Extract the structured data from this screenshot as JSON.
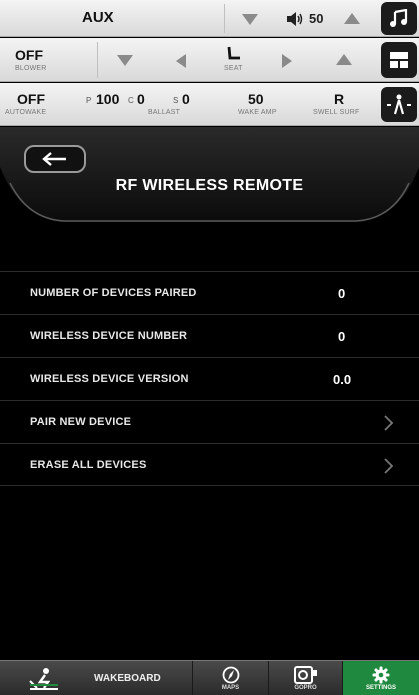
{
  "topbar": {
    "audio_source": "AUX",
    "volume": "50",
    "blower_value": "OFF",
    "blower_label": "BLOWER",
    "seat_label": "SEAT",
    "autowake_value": "OFF",
    "autowake_label": "AUTOWAKE",
    "ballast_p_label": "P",
    "ballast_p_value": "100",
    "ballast_c_label": "C",
    "ballast_c_value": "0",
    "ballast_s_label": "S",
    "ballast_s_value": "0",
    "ballast_label": "BALLAST",
    "wake_amp_value": "50",
    "wake_amp_label": "WAKE AMP",
    "swell_surf_value": "R",
    "swell_surf_label": "SWELL SURF"
  },
  "header": {
    "title": "RF WIRELESS REMOTE"
  },
  "settings": [
    {
      "label": "NUMBER OF DEVICES PAIRED",
      "value": "0"
    },
    {
      "label": "WIRELESS DEVICE NUMBER",
      "value": "0"
    },
    {
      "label": "WIRELESS DEVICE VERSION",
      "value": "0.0"
    },
    {
      "label": "PAIR NEW DEVICE",
      "value": ""
    },
    {
      "label": "ERASE ALL DEVICES",
      "value": ""
    }
  ],
  "nav": {
    "wakeboard": "WAKEBOARD",
    "maps": "MAPS",
    "gopro": "GOPRO",
    "settings": "SETTINGS"
  },
  "colors": {
    "accent_green": "#1f8a3f",
    "background": "#000000",
    "status_bar": "#e6e6e6"
  },
  "icons": [
    "music-note-icon",
    "layout-icon",
    "wake-wave-icon",
    "back-arrow-icon",
    "chevron-right-icon",
    "rider-icon",
    "compass-icon",
    "camera-icon",
    "gear-icon",
    "speaker-icon",
    "seat-icon"
  ]
}
